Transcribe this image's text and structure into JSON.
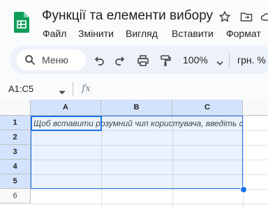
{
  "header": {
    "title": "Функції та елементи вибору",
    "logo_icon": "google-sheets-logo",
    "icons": [
      "star-icon",
      "move-to-folder-icon",
      "cloud-status-icon"
    ]
  },
  "menu": {
    "file": "Файл",
    "edit": "Змінити",
    "view": "Вигляд",
    "insert": "Вставити",
    "format": "Формат"
  },
  "toolbar": {
    "search_label": "Меню",
    "zoom": "100%",
    "currency": "грн. %"
  },
  "formula_bar": {
    "name_box": "A1:C5",
    "fx": "fx"
  },
  "grid": {
    "columns": [
      "A",
      "B",
      "C"
    ],
    "rows": [
      "1",
      "2",
      "3",
      "4",
      "5",
      "6"
    ],
    "selected_range": "A1:C5",
    "cell_a1_placeholder": "Щоб вставити розумний чип користувача, введіть с"
  },
  "colors": {
    "accent": "#1a73e8",
    "selected_header": "#d3e3fd",
    "toolbar_bg": "#edf2fa"
  }
}
